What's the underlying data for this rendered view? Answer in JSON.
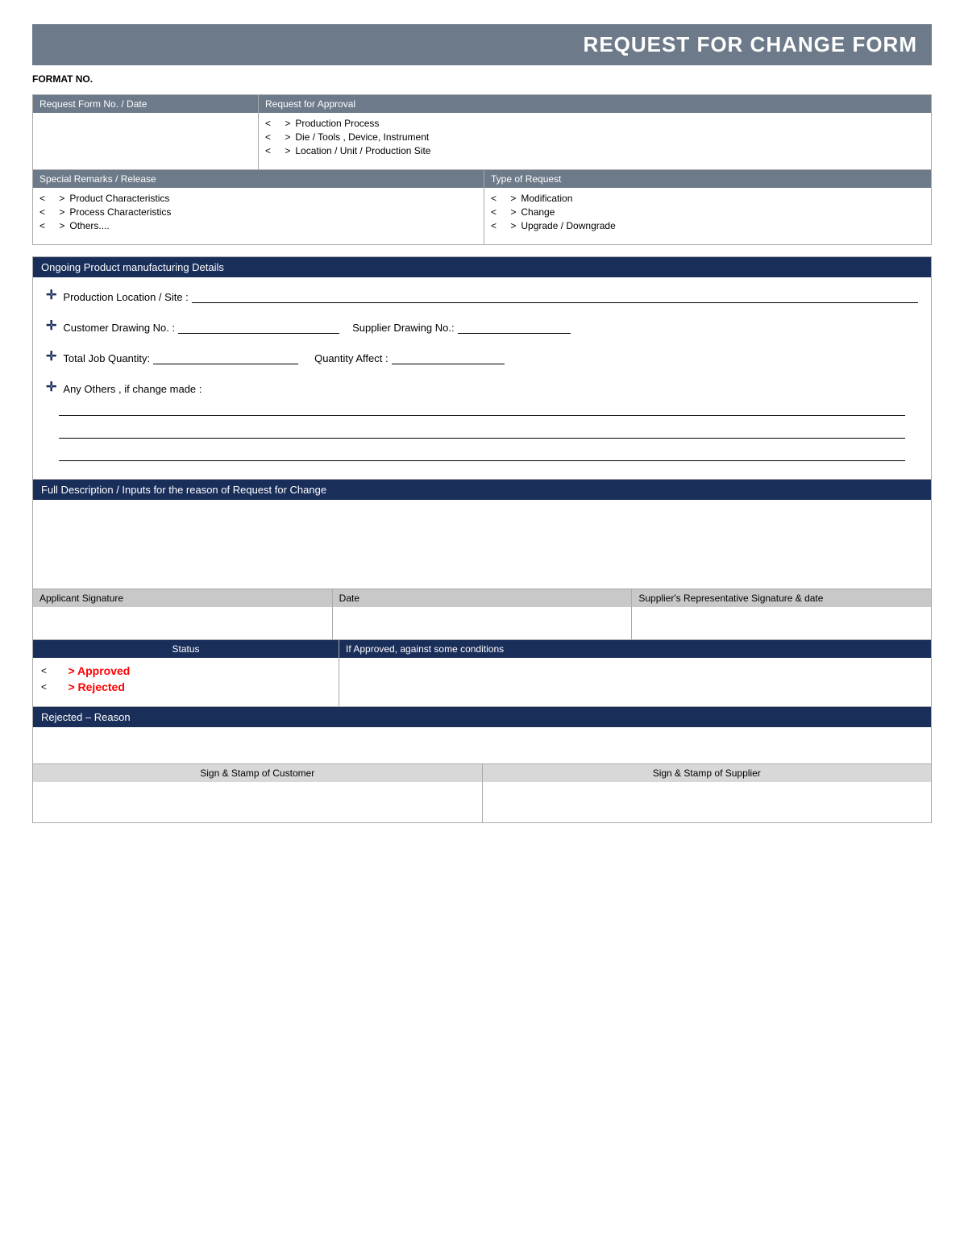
{
  "title": "REQUEST FOR CHANGE FORM",
  "format_no_label": "FORMAT NO.",
  "top": {
    "left_header": "Request Form No. / Date",
    "right_header": "Request for Approval",
    "approval_items": [
      {
        "bracket": "<",
        "arrow": ">",
        "label": "Production Process"
      },
      {
        "bracket": "<",
        "arrow": ">",
        "label": "Die / Tools , Device, Instrument"
      },
      {
        "bracket": "<",
        "arrow": ">",
        "label": "Location / Unit / Production Site"
      }
    ]
  },
  "second": {
    "left_header": "Special Remarks / Release",
    "left_items": [
      {
        "bracket": "<",
        "arrow": ">",
        "label": "Product Characteristics"
      },
      {
        "bracket": "<",
        "arrow": ">",
        "label": "Process Characteristics"
      },
      {
        "bracket": "<",
        "arrow": ">",
        "label": "Others...."
      }
    ],
    "right_header": "Type of Request",
    "right_items": [
      {
        "bracket": "<",
        "arrow": ">",
        "label": "Modification"
      },
      {
        "bracket": "<",
        "arrow": ">",
        "label": "Change"
      },
      {
        "bracket": "<",
        "arrow": ">",
        "label": "Upgrade / Downgrade"
      }
    ]
  },
  "ongoing": {
    "header": "Ongoing Product manufacturing Details",
    "fields": [
      {
        "icon": "✛",
        "label": "Production Location / Site :"
      },
      {
        "icon": "✛",
        "label": "Customer Drawing No. :",
        "label2": "Supplier Drawing No.:"
      },
      {
        "icon": "✛",
        "label": "Total Job Quantity:",
        "label2": "Quantity Affect :"
      },
      {
        "icon": "✛",
        "label": "Any Others , if change made :"
      }
    ]
  },
  "description": {
    "header": "Full Description / Inputs for the reason of Request for Change"
  },
  "signatures": {
    "applicant": "Applicant Signature",
    "date": "Date",
    "supplier": "Supplier's Representative Signature & date"
  },
  "status": {
    "header": "Status",
    "if_approved_header": "If Approved,  against some conditions",
    "options": [
      {
        "bracket": "<",
        "arrow": ">",
        "label": "Approved",
        "type": "approved"
      },
      {
        "bracket": "<",
        "arrow": ">",
        "label": "Rejected",
        "type": "rejected"
      }
    ]
  },
  "rejected_reason": {
    "header": "Rejected – Reason"
  },
  "stamps": {
    "customer": "Sign & Stamp of Customer",
    "supplier": "Sign & Stamp of Supplier"
  }
}
